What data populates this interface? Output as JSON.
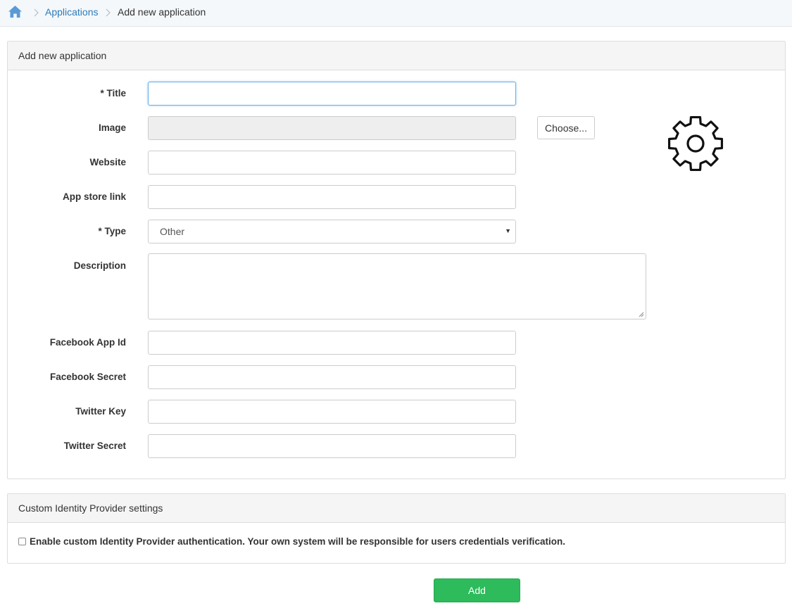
{
  "breadcrumb": {
    "home_icon": "home-icon",
    "link": "Applications",
    "current": "Add new application"
  },
  "form_panel": {
    "title": "Add new application",
    "fields": {
      "title": {
        "label": "* Title",
        "value": ""
      },
      "image": {
        "label": "Image",
        "value": "",
        "button": "Choose..."
      },
      "website": {
        "label": "Website",
        "value": ""
      },
      "app_store_link": {
        "label": "App store link",
        "value": ""
      },
      "type": {
        "label": "* Type",
        "value": "Other"
      },
      "description": {
        "label": "Description",
        "value": ""
      },
      "facebook_app_id": {
        "label": "Facebook App Id",
        "value": ""
      },
      "facebook_secret": {
        "label": "Facebook Secret",
        "value": ""
      },
      "twitter_key": {
        "label": "Twitter Key",
        "value": ""
      },
      "twitter_secret": {
        "label": "Twitter Secret",
        "value": ""
      }
    },
    "image_placeholder_icon": "gear-icon"
  },
  "idp_panel": {
    "title": "Custom Identity Provider settings",
    "checkbox_label": "Enable custom Identity Provider authentication. Your own system will be responsible for users credentials verification.",
    "checked": false
  },
  "actions": {
    "add_label": "Add"
  },
  "colors": {
    "accent": "#2e7ab8",
    "add_button": "#2dbb5c",
    "focus_border": "#66afe9"
  }
}
